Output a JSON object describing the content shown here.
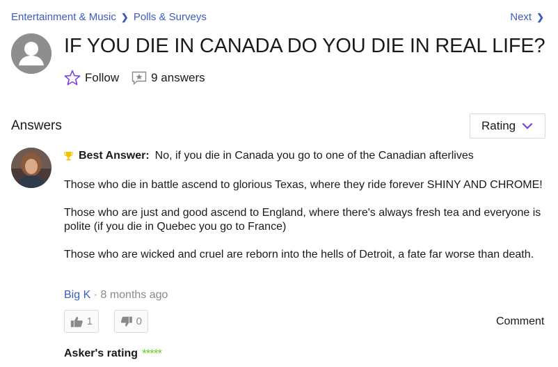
{
  "breadcrumb": {
    "category": "Entertainment & Music",
    "subcategory": "Polls & Surveys"
  },
  "nav": {
    "next_label": "Next"
  },
  "question": {
    "title": "IF YOU DIE IN CANADA DO YOU DIE IN REAL LIFE?",
    "follow_label": "Follow",
    "answers_count_label": "9 answers"
  },
  "answers_section": {
    "heading": "Answers",
    "sort": {
      "selected": "Rating"
    }
  },
  "best_answer": {
    "label": "Best Answer:",
    "first_line": "No, if you die in Canada you go to one of the Canadian afterlives",
    "paragraphs": [
      "Those who die in battle ascend to glorious Texas, where they ride forever SHINY AND CHROME!",
      "Those who are just and good ascend to England, where there's always fresh tea and everyone is polite (if you die in Quebec you go to France)",
      "Those who are wicked and cruel are reborn into the hells of Detroit, a fate far worse than death."
    ],
    "author": "Big K",
    "separator": "·",
    "time_ago": "8 months ago",
    "upvotes": "1",
    "downvotes": "0",
    "comment_label": "Comment",
    "asker_rating_label": "Asker's rating",
    "asker_rating_stars": "*****"
  },
  "colors": {
    "link": "#3b5bc8",
    "accent": "#7b3fe4",
    "stars": "#6bcf1d"
  }
}
